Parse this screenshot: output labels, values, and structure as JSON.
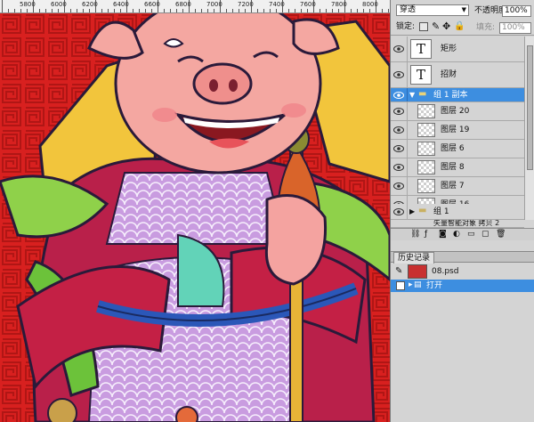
{
  "ruler": {
    "labels": [
      "5800",
      "6000",
      "6200",
      "6400",
      "6600",
      "6800",
      "7000",
      "7200",
      "7400",
      "7600",
      "7800",
      "8000"
    ]
  },
  "layers_panel": {
    "blend_mode": "穿透",
    "opacity_label": "不透明度:",
    "opacity_value": "100%",
    "lock_label": "锁定:",
    "fill_label": "填充:",
    "fill_value": "100%",
    "layers": [
      {
        "name": "矩形",
        "kind": "text",
        "thumb": "T"
      },
      {
        "name": "招财",
        "kind": "text",
        "thumb": "T"
      },
      {
        "name": "组 1 副本",
        "kind": "group"
      },
      {
        "name": "图层 20",
        "kind": "pixel"
      },
      {
        "name": "图层 19",
        "kind": "pixel"
      },
      {
        "name": "图层 6",
        "kind": "pixel"
      },
      {
        "name": "图层 8",
        "kind": "pixel"
      },
      {
        "name": "图层 7",
        "kind": "pixel"
      },
      {
        "name": "图层 16",
        "kind": "pixel"
      },
      {
        "name": "组 1",
        "kind": "group"
      },
      {
        "name": "矢量智能对象 拷贝 2",
        "kind": "smart"
      }
    ]
  },
  "history_panel": {
    "tab_label": "历史记录",
    "snapshot_name": "08.psd",
    "step_label": "打开"
  },
  "colors": {
    "selection": "#3d8ee0",
    "canvas_red": "#d8201f",
    "panel_bg": "#d4d4d4"
  }
}
